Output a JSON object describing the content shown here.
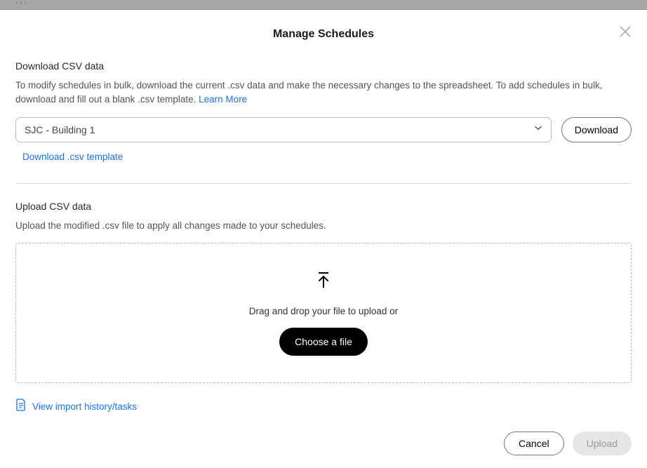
{
  "modal": {
    "title": "Manage Schedules"
  },
  "download": {
    "heading": "Download CSV data",
    "description": "To modify schedules in bulk, download the current .csv data and make the necessary changes to the spreadsheet. To add schedules in bulk, download and fill out a blank .csv template. ",
    "learn_more": "Learn More",
    "select_value": "SJC - Building 1",
    "download_btn": "Download",
    "template_link": "Download .csv template"
  },
  "upload": {
    "heading": "Upload CSV data",
    "description": "Upload the modified .csv file to apply all changes made to your schedules.",
    "drop_text": "Drag and drop your file to upload or",
    "choose_btn": "Choose a file"
  },
  "history": {
    "link": "View import history/tasks"
  },
  "footer": {
    "cancel": "Cancel",
    "upload": "Upload"
  }
}
